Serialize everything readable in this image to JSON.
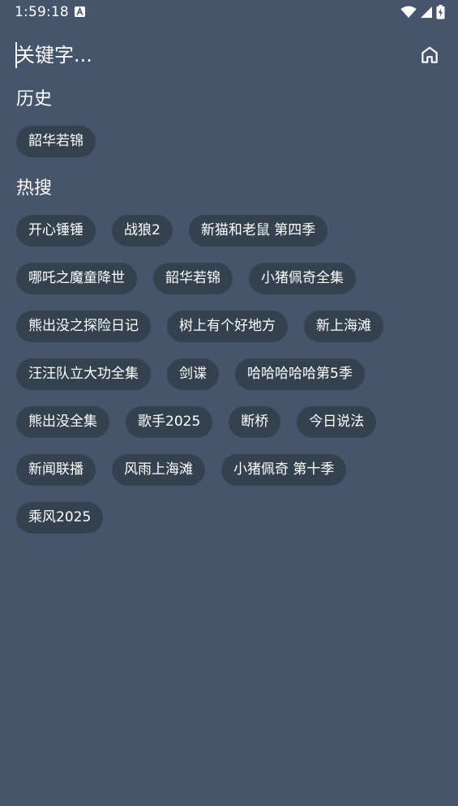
{
  "status_bar": {
    "time": "1:59:18",
    "notification_icon": "font-a-icon",
    "wifi_icon": "wifi-icon",
    "signal_icon": "cell-signal-icon",
    "battery_icon": "battery-charging-icon"
  },
  "search": {
    "placeholder": "关键字...",
    "home_icon": "home-icon"
  },
  "history": {
    "title": "历史",
    "items": [
      "韶华若锦"
    ]
  },
  "hot": {
    "title": "热搜",
    "items": [
      "开心锤锤",
      "战狼2",
      "新猫和老鼠 第四季",
      "哪吒之魔童降世",
      "韶华若锦",
      "小猪佩奇全集",
      "熊出没之探险日记",
      "树上有个好地方",
      "新上海滩",
      "汪汪队立大功全集",
      "剑谍",
      "哈哈哈哈哈第5季",
      "熊出没全集",
      "歌手2025",
      "断桥",
      "今日说法",
      "新闻联播",
      "风雨上海滩",
      "小猪佩奇 第十季",
      "乘风2025"
    ]
  },
  "colors": {
    "background": "#46556b",
    "chip_background": "#34414f",
    "text": "#ffffff"
  }
}
